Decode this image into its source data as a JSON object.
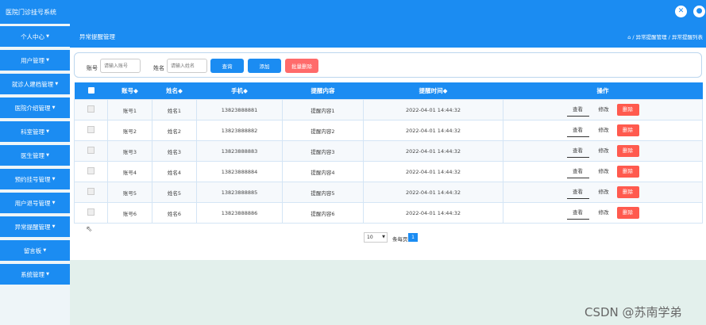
{
  "app": {
    "title": "医院门诊挂号系统"
  },
  "topbar": {
    "icons": [
      "close-icon",
      "user-icon"
    ],
    "close_glyph": "✕",
    "user_glyph": "●"
  },
  "sidebar": {
    "items": [
      {
        "label": "个人中心"
      },
      {
        "label": "用户管理"
      },
      {
        "label": "就诊人建档管理"
      },
      {
        "label": "医院介绍管理"
      },
      {
        "label": "科室管理"
      },
      {
        "label": "医生管理"
      },
      {
        "label": "预约挂号管理"
      },
      {
        "label": "用户退号管理"
      },
      {
        "label": "异常提醒管理"
      },
      {
        "label": "留言板"
      },
      {
        "label": "系统管理"
      }
    ]
  },
  "header": {
    "page_title": "异常提醒管理",
    "breadcrumb": "⌂ / 异常提醒管理 / 异常提醒列表"
  },
  "search": {
    "account_label": "账号",
    "account_placeholder": "请输入账号",
    "name_label": "姓名",
    "name_placeholder": "请输入姓名",
    "query_button": "查询",
    "add_button": "添加",
    "batch_delete_button": "批量删除"
  },
  "table": {
    "columns": [
      "账号◆",
      "姓名◆",
      "手机◆",
      "提醒内容",
      "提醒时间◆",
      "操作"
    ],
    "rows": [
      {
        "account": "账号1",
        "name": "姓名1",
        "phone": "13823888881",
        "content": "提醒内容1",
        "time": "2022-04-01 14:44:32"
      },
      {
        "account": "账号2",
        "name": "姓名2",
        "phone": "13823888882",
        "content": "提醒内容2",
        "time": "2022-04-01 14:44:32"
      },
      {
        "account": "账号3",
        "name": "姓名3",
        "phone": "13823888883",
        "content": "提醒内容3",
        "time": "2022-04-01 14:44:32"
      },
      {
        "account": "账号4",
        "name": "姓名4",
        "phone": "13823888884",
        "content": "提醒内容4",
        "time": "2022-04-01 14:44:32"
      },
      {
        "account": "账号5",
        "name": "姓名5",
        "phone": "13823888885",
        "content": "提醒内容5",
        "time": "2022-04-01 14:44:32"
      },
      {
        "account": "账号6",
        "name": "姓名6",
        "phone": "13823888886",
        "content": "提醒内容6",
        "time": "2022-04-01 14:44:32"
      }
    ],
    "actions": {
      "view": "查看",
      "edit": "修改",
      "delete": "删除"
    }
  },
  "pagination": {
    "page_size": "10",
    "page_size_label": "条每页",
    "current_page": "1"
  },
  "watermark": "CSDN @苏南学弟",
  "colors": {
    "primary": "#1b8cf2",
    "danger": "#ff5a4e",
    "batch_delete": "#ff6b6b"
  }
}
